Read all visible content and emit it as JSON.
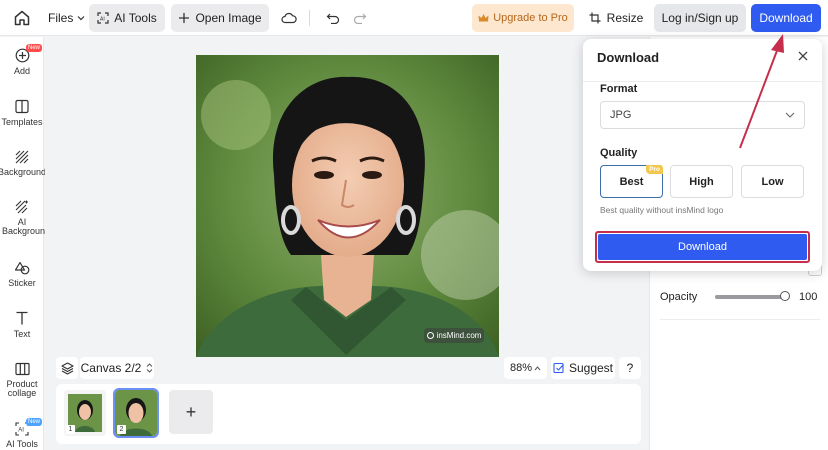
{
  "topbar": {
    "files_label": "Files",
    "ai_tools_label": "AI Tools",
    "open_image_label": "Open Image",
    "upgrade_label": "Upgrade to Pro",
    "resize_label": "Resize",
    "login_label": "Log in/Sign up",
    "download_label": "Download"
  },
  "sidebar": {
    "items": [
      {
        "label": "Add",
        "icon": "plus-circle-icon",
        "badge": "New"
      },
      {
        "label": "Templates",
        "icon": "templates-icon"
      },
      {
        "label": "Background",
        "icon": "background-icon"
      },
      {
        "label": "AI Background",
        "icon": "ai-background-icon"
      },
      {
        "label": "Sticker",
        "icon": "sticker-icon"
      },
      {
        "label": "Text",
        "icon": "text-icon"
      },
      {
        "label": "Product collage",
        "icon": "collage-icon"
      },
      {
        "label": "AI Tools",
        "icon": "ai-tools-icon",
        "badge": "New"
      }
    ]
  },
  "canvas": {
    "watermark": "insMind.com",
    "canvas_selector": "Canvas 2/2",
    "zoom": "88%",
    "suggest_label": "Suggest",
    "help_label": "?",
    "thumbnails": [
      {
        "number": "1",
        "selected": false
      },
      {
        "number": "2",
        "selected": true
      }
    ],
    "add_page_label": "+"
  },
  "panel": {
    "opacity_label": "Opacity",
    "opacity_value": "100",
    "opacity_level": 1.0
  },
  "download_dialog": {
    "title": "Download",
    "format_label": "Format",
    "format_value": "JPG",
    "quality_label": "Quality",
    "quality_options": [
      {
        "label": "Best",
        "selected": true,
        "badge": "Pro"
      },
      {
        "label": "High",
        "selected": false
      },
      {
        "label": "Low",
        "selected": false
      }
    ],
    "quality_note": "Best quality without insMind logo",
    "download_button": "Download"
  },
  "colors": {
    "accent_blue": "#2f5bf0",
    "highlight_red": "#c62f4c",
    "upgrade_bg": "#fde8cf",
    "upgrade_text": "#b6671a",
    "pro_badge": "#f3c64e",
    "new_badge": "#ff4d4f"
  }
}
